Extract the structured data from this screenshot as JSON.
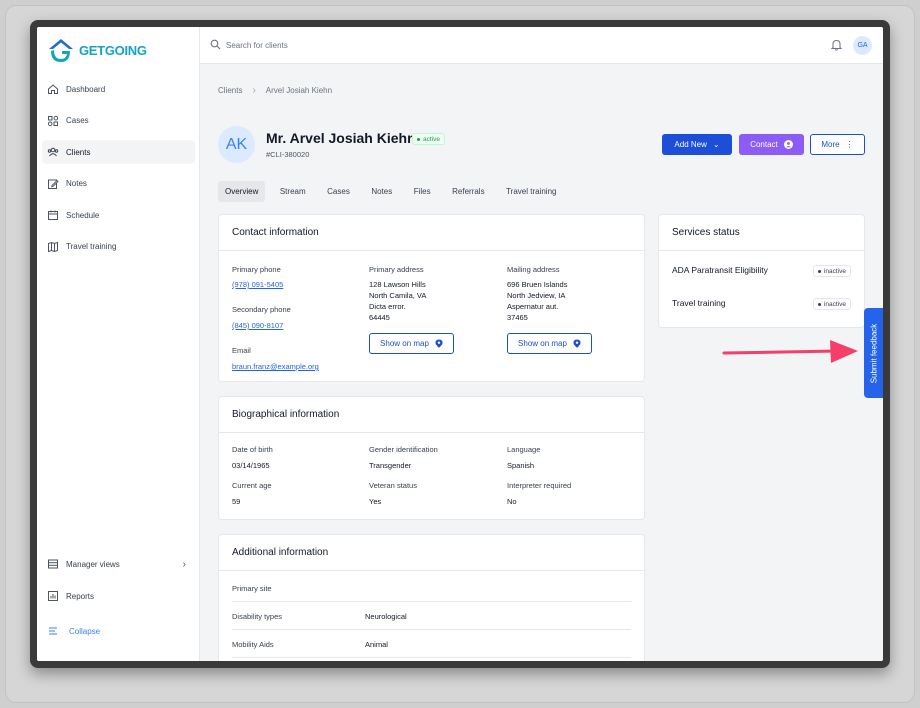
{
  "app": {
    "brand": "GETGOING"
  },
  "search": {
    "placeholder": "Search for clients"
  },
  "user": {
    "initials": "GA"
  },
  "sidebar": {
    "items": [
      {
        "label": "Dashboard",
        "icon": "home-icon"
      },
      {
        "label": "Cases",
        "icon": "cases-icon"
      },
      {
        "label": "Clients",
        "icon": "users-icon",
        "active": true
      },
      {
        "label": "Notes",
        "icon": "pencil-icon"
      },
      {
        "label": "Schedule",
        "icon": "calendar-icon"
      },
      {
        "label": "Travel training",
        "icon": "map-icon"
      }
    ],
    "bottom": [
      {
        "label": "Manager views",
        "icon": "table-icon"
      },
      {
        "label": "Reports",
        "icon": "chart-icon"
      }
    ],
    "collapse_label": "Collapse"
  },
  "breadcrumb": {
    "root": "Clients",
    "current": "Arvel Josiah Kiehn"
  },
  "client": {
    "initials": "AK",
    "name": "Mr. Arvel Josiah Kiehn",
    "status": "active",
    "id": "#CLI-380020"
  },
  "actions": {
    "add_new": "Add New",
    "contact": "Contact",
    "more": "More"
  },
  "tabs": [
    "Overview",
    "Stream",
    "Cases",
    "Notes",
    "Files",
    "Referrals",
    "Travel training"
  ],
  "contact": {
    "title": "Contact information",
    "primary_phone_label": "Primary phone",
    "primary_phone": "(978) 091-5405",
    "secondary_phone_label": "Secondary phone",
    "secondary_phone": "(845) 090-8107",
    "email_label": "Email",
    "email": "braun.franz@example.org",
    "primary_address_label": "Primary address",
    "primary_address": [
      "128 Lawson Hills",
      "North Camila, VA",
      "Dicta error.",
      "64445"
    ],
    "mailing_address_label": "Mailing address",
    "mailing_address": [
      "696 Bruen Islands",
      "North Jedview, IA",
      "Aspernatur aut.",
      "37465"
    ],
    "show_on_map": "Show on map"
  },
  "bio": {
    "title": "Biographical information",
    "dob_label": "Date of birth",
    "dob": "03/14/1965",
    "gender_label": "Gender identification",
    "gender": "Transgender",
    "language_label": "Language",
    "language": "Spanish",
    "age_label": "Current age",
    "age": "59",
    "veteran_label": "Veteran status",
    "veteran": "Yes",
    "interpreter_label": "Interpreter required",
    "interpreter": "No"
  },
  "additional": {
    "title": "Additional information",
    "rows": [
      {
        "label": "Primary site",
        "value": ""
      },
      {
        "label": "Disability types",
        "value": "Neurological"
      },
      {
        "label": "Mobility Aids",
        "value": "Animal"
      }
    ]
  },
  "services": {
    "title": "Services status",
    "items": [
      {
        "name": "ADA Paratransit Eligibility",
        "status": "inactive"
      },
      {
        "name": "Travel training",
        "status": "inactive"
      }
    ]
  },
  "feedback": {
    "label": "Submit feedback"
  },
  "colors": {
    "primary": "#1d4ed8",
    "contact": "#8b5cf6",
    "annotation_arrow": "#f43f6b"
  }
}
